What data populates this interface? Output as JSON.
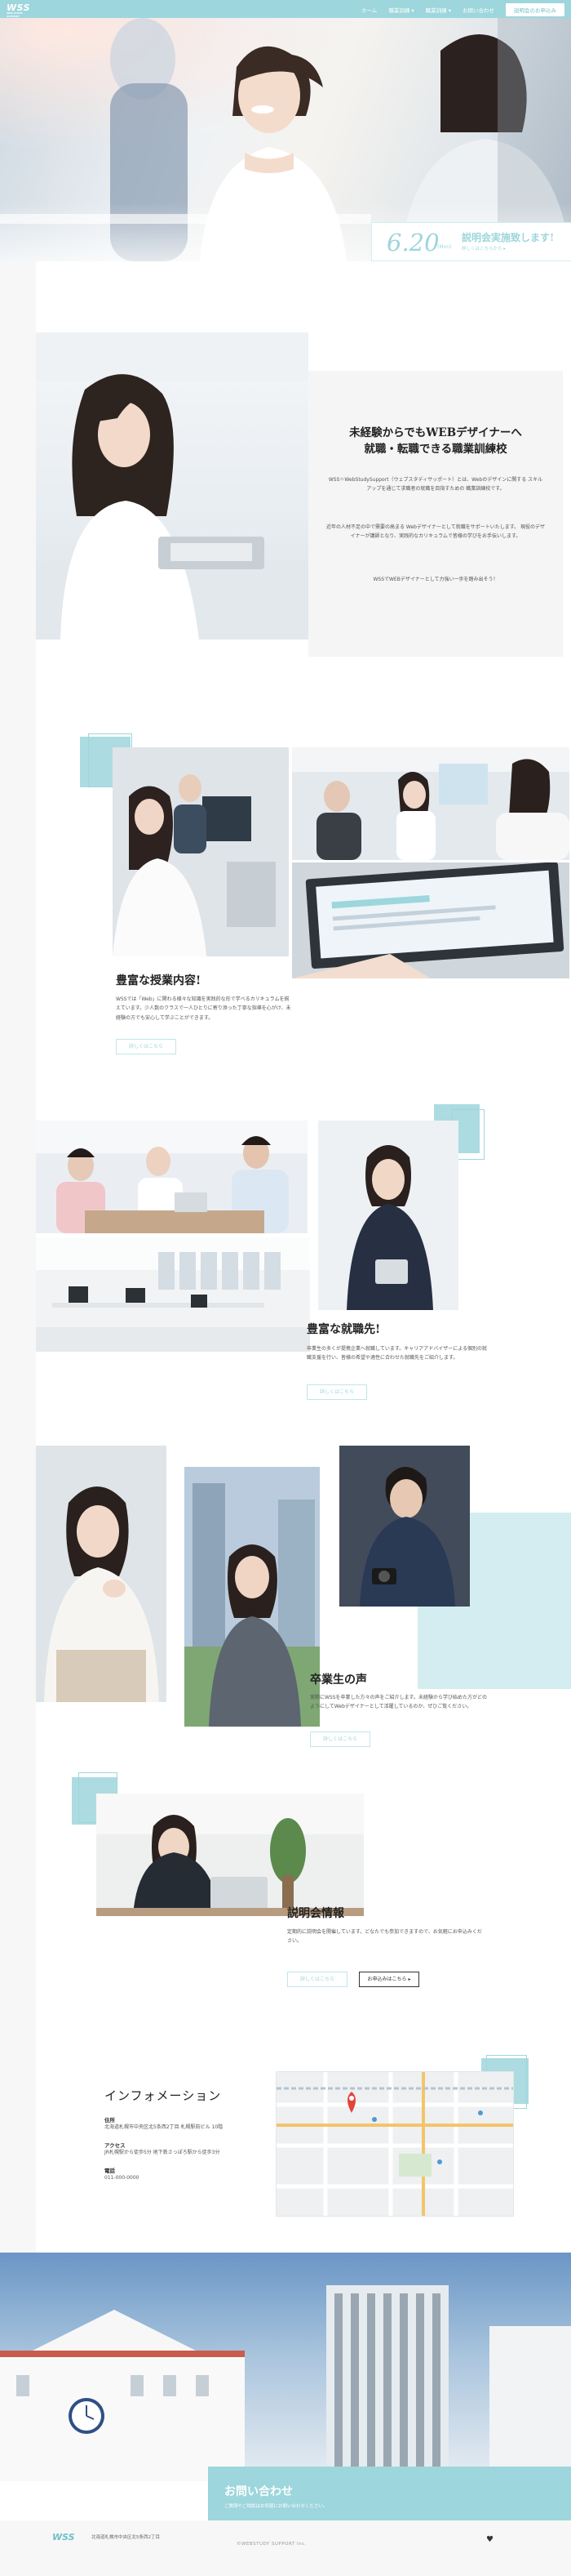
{
  "header": {
    "logo_text": "WSS",
    "logo_sub": "WEB STUDY SUPPORT",
    "nav": [
      "ホーム",
      "職業訓練 ▾",
      "職業訓練 ▾",
      "お問い合わせ"
    ],
    "cta_label": "説明会のお申込み"
  },
  "event": {
    "date": "6.20",
    "day": "(Mon)",
    "title": "説明会実施致します!",
    "sub": "詳しくはこちらから ▸"
  },
  "intro": {
    "title_line1": "未経験からでもWEBデザイナーへ",
    "title_line2": "就職・転職できる職業訓練校",
    "p1": "WSS＝WebStudySupport（ウェブスタディサッポート）とは、Webのデザインに関する スキルアップを通じて求職者の就職を目指すための 職業訓練校です。",
    "p2": "近年の人材不足の中で需要の高まる Webデザイナーとして就職をサポートいたします。 現役のデザイナーが講師となり、実践的なカリキュラムで皆様の学びをお手伝いします。",
    "p3": "WSSでWEBデザイナーとして力強い一歩を踏み出そう！"
  },
  "features": [
    {
      "title": "豊富な授業内容!",
      "text": "WSSでは「Web」に関わる様々な知識を実践的な形で学べるカリキュラムを揃えています。少人数のクラスで一人ひとりに寄り添った丁寧な指導を心がけ、未経験の方でも安心して学ぶことができます。",
      "button": "詳しくはこちら"
    },
    {
      "title": "豊富な就職先!",
      "text": "卒業生の多くが提携企業へ就職しています。キャリアアドバイザーによる個別の就職支援を行い、皆様の希望や適性に合わせた就職先をご紹介します。",
      "button": "詳しくはこちら"
    },
    {
      "title": "卒業生の声",
      "text": "実際にWSSを卒業した方々の声をご紹介します。未経験から学び始めた方がどのようにしてWebデザイナーとして活躍しているのか、ぜひご覧ください。",
      "button": "詳しくはこちら"
    },
    {
      "title": "説明会情報",
      "text": "定期的に説明会を開催しています。どなたでも参加できますので、お気軽にお申込みください。",
      "button": "詳しくはこちら",
      "button2": "お申込みはこちら ▸"
    }
  ],
  "info": {
    "title": "インフォメーション",
    "rows": [
      {
        "label": "住所",
        "value": "北海道札幌市中央区北5条西2丁目 札幌駅前ビル 10階"
      },
      {
        "label": "アクセス",
        "value": "JR札幌駅から徒歩5分 地下鉄さっぽろ駅から徒歩3分"
      },
      {
        "label": "電話",
        "value": "011-000-0000"
      }
    ]
  },
  "contact": {
    "title": "お問い合わせ",
    "sub": "ご質問やご相談はお気軽にお問い合わせください。"
  },
  "footer": {
    "logo": "WSS",
    "address": "北海道札幌市中央区北5条西2丁目",
    "copyright": "©WEBSTUDY SUPPORT Inc.",
    "icon": "heart-icon"
  },
  "colors": {
    "accent": "#9dd6dc",
    "accent_dark": "#6fbfc7",
    "bg_gray": "#f5f5f5"
  }
}
